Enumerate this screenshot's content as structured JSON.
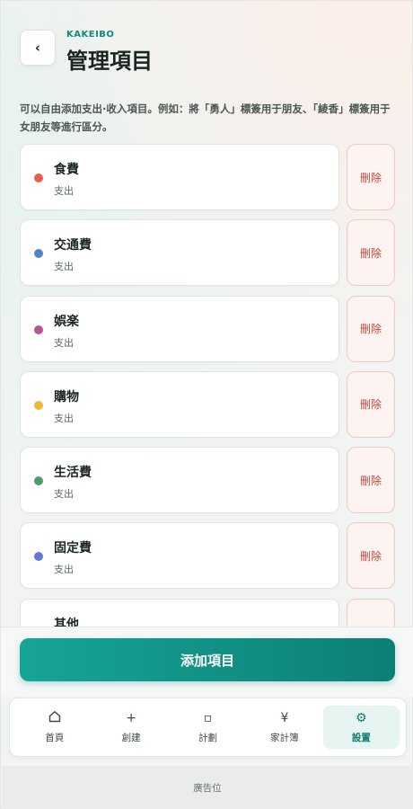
{
  "header": {
    "back_icon": "chevron-left-icon",
    "back_glyph": "‹",
    "kicker": "KAKEIBO",
    "title": "管理項目"
  },
  "description": "可以自由添加支出·收入項目。例如：將「勇人」標簽用于朋友、「綾香」標簽用于女朋友等進行區分。",
  "categories": [
    {
      "name": "食費",
      "type": "支出",
      "color": "#e8604c",
      "delete_label": "刪除"
    },
    {
      "name": "交通費",
      "type": "支出",
      "color": "#4d86c8",
      "delete_label": "刪除"
    },
    {
      "name": "娯楽",
      "type": "支出",
      "color": "#b8558f",
      "delete_label": "刪除"
    },
    {
      "name": "購物",
      "type": "支出",
      "color": "#f0b73a",
      "delete_label": "刪除"
    },
    {
      "name": "生活費",
      "type": "支出",
      "color": "#4f9a6a",
      "delete_label": "刪除"
    },
    {
      "name": "固定費",
      "type": "支出",
      "color": "#6679d1",
      "delete_label": "刪除"
    },
    {
      "name": "其他",
      "type": "",
      "color": "",
      "delete_label": ""
    }
  ],
  "add_button_label": "添加項目",
  "tabbar": {
    "active": "settings",
    "tabs": [
      {
        "id": "home",
        "icon": "home-icon",
        "glyph": "",
        "label": "首頁"
      },
      {
        "id": "create",
        "icon": "plus-icon",
        "glyph": "+",
        "label": "創建"
      },
      {
        "id": "plan",
        "icon": "square-icon",
        "glyph": "▫",
        "label": "計劃"
      },
      {
        "id": "ledger",
        "icon": "yen-icon",
        "glyph": "¥",
        "label": "家計簿"
      },
      {
        "id": "settings",
        "icon": "gear-icon",
        "glyph": "⚙",
        "label": "設置"
      }
    ]
  },
  "ad_label": "廣告位",
  "colors": {
    "accent": "#128a79",
    "danger": "#c04a3c"
  }
}
